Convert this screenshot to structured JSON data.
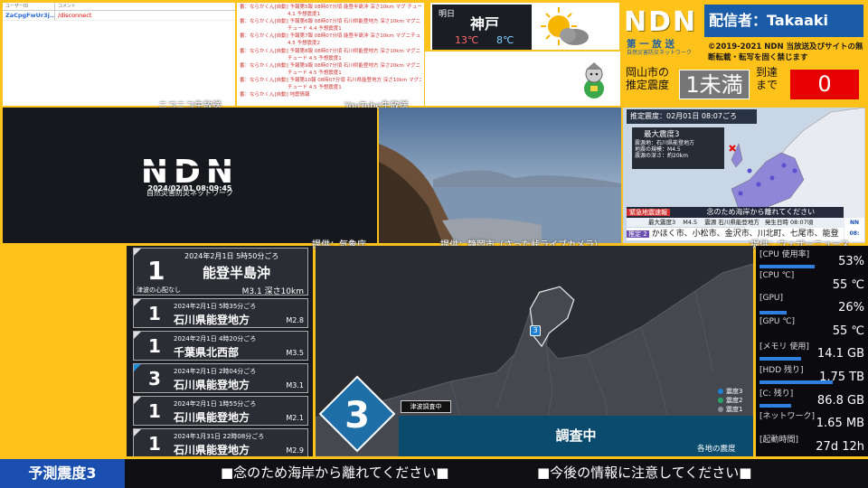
{
  "chat": {
    "header_user": "ユーザーID",
    "header_comment": "コメント",
    "user": "ZaCpgFwUr3j...",
    "message": "/disconnect",
    "source_label": "ニコニコ生放送"
  },
  "youtube": {
    "source_label": "YouTube生放送",
    "lines": [
      "番：ならかくん[自動] 予報第5報 08時07分頃 能登半島沖 深さ10km マグ  チュード",
      "4.1 予想震度1",
      "番：ならかくん[自動] 予報第6報 08時07分頃 石川県能登地方 深さ10km マグニ",
      "チュード 4.4 予想震度1",
      "番：ならかくん[自動] 予報第7報 08時07分頃 能登半島沖 深さ10km マグニチュード",
      "4.5 予想震度2",
      "番：ならかくん[自動] 予報第8報 08時07分頃 石川県能登地方 深さ10km マグニ",
      "チュード 4.5 予想震度1",
      "番：ならかくん[自動] 予報第9報 08時07分頃 石川県能登地方 深さ20km マグニ",
      "チュード 4.5 予想震度1",
      "番：ならかくん[自動] 予報第10報 08時07分頃 石川県能登地方 深さ10km マグニ",
      "チュード 4.5 予想震度1",
      "番：ならかくん[自動] 地震情報"
    ]
  },
  "weather": {
    "day": "明日",
    "city": "神戸",
    "high": "13℃",
    "low": "8℃",
    "icon": "partly-cloudy-icon"
  },
  "header": {
    "logo": "NDN",
    "distributor": "配信者：Takaaki",
    "bosai_title": "第 一 放 送",
    "bosai_sub": "自然災害防災ネットワーク",
    "copyright": "©2019-2021 NDN 当放送及びサイトの無断転載・転写を固く禁じます",
    "pref_label_1": "岡山市の",
    "pref_label_2": "推定震度",
    "pref_value": "1未満",
    "arrival_label_1": "到達",
    "arrival_label_2": "まで",
    "arrival_value": "0"
  },
  "ndn_panel": {
    "logo": "NDN",
    "sub": "自然災害防災ネットワーク",
    "datetime": "2024/02/01 08:09:45",
    "source_label": "提供：気象庁"
  },
  "camera": {
    "source_label": "提供：静岡市（さった峠ライブカメラ）"
  },
  "eew_map": {
    "source_label": "提供：ウェザーニュース",
    "title": "推定震度：02月01日 08:07ごろ",
    "max_label": "最大震度3",
    "epicenter_label": "震源地",
    "epicenter": "：石川県能登地方",
    "mag_label": "地震の規模",
    "mag": "：M4.5",
    "depth_label": "震源の深さ",
    "depth": "：約20km",
    "banner_title": "緊急地震速報",
    "banner_msg": "念のため海岸から離れてください",
    "info_max": "最大震度3",
    "info_mag": "M4.5",
    "info_epi_label": "震源",
    "info_epi": "石川県能登地方",
    "info_time_label": "発生日時",
    "info_time": "08:07頃",
    "scroll_tag": "推定 2",
    "scroll_text": "かほく市、小松市、金沢市、川北町、七尾市、能登",
    "channel_tag": "NN 08:"
  },
  "eqlist": {
    "main": {
      "time": "2024年2月1日 5時50分ごろ",
      "intensity": "1",
      "area": "能登半島沖",
      "mag": "M3.1 深さ10km",
      "tsunami": "津波の心配なし"
    },
    "items": [
      {
        "time": "2024年2月1日 5時35分ごろ",
        "intensity": "1",
        "area": "石川県能登地方",
        "mag": "M2.8",
        "tri": "white"
      },
      {
        "time": "2024年2月1日 4時20分ごろ",
        "intensity": "1",
        "area": "千葉県北西部",
        "mag": "M3.5",
        "tri": "white"
      },
      {
        "time": "2024年2月1日 2時04分ごろ",
        "intensity": "3",
        "area": "石川県能登地方",
        "mag": "M3.1",
        "tri": "blue"
      },
      {
        "time": "2024年2月1日 1時55分ごろ",
        "intensity": "1",
        "area": "石川県能登地方",
        "mag": "M2.1",
        "tri": "white"
      },
      {
        "time": "2024年1月31日 22時08分ごろ",
        "intensity": "1",
        "area": "石川県能登地方",
        "mag": "M2.9",
        "tri": "white"
      }
    ]
  },
  "map": {
    "max_intensity": "3",
    "marker": "3",
    "tsunami_check": "津波調査中",
    "status": "調査中",
    "caption": "各地の震度",
    "legend": [
      {
        "label": "震度3",
        "color": "#1e7fd0"
      },
      {
        "label": "震度2",
        "color": "#2aa56a"
      },
      {
        "label": "震度1",
        "color": "#8a8f98"
      }
    ]
  },
  "sysmon": [
    {
      "label": "[CPU 使用率]",
      "value": "53%",
      "fill": 0.53
    },
    {
      "label": "[CPU ℃]",
      "value": "55 ℃",
      "fill": 0
    },
    {
      "label": "[GPU]",
      "value": "26%",
      "fill": 0.26
    },
    {
      "label": "[GPU ℃]",
      "value": "55 ℃",
      "fill": 0
    },
    {
      "label": "[メモリ 使用]",
      "value": "14.1 GB",
      "fill": 0.4
    },
    {
      "label": "[HDD 残り]",
      "value": "1.75 TB",
      "fill": 0.7
    },
    {
      "label": "[C: 残り]",
      "value": "86.8 GB",
      "fill": 0.3
    },
    {
      "label": "[ネットワーク]",
      "value": "1.65 MB",
      "fill": 0
    },
    {
      "label": "[起動時間]",
      "value": "27d 12h",
      "fill": 0
    }
  ],
  "ticker": {
    "label": "予測震度3",
    "msg1": "■念のため海岸から離れてください■",
    "msg2": "■今後の情報に注意してください■"
  }
}
